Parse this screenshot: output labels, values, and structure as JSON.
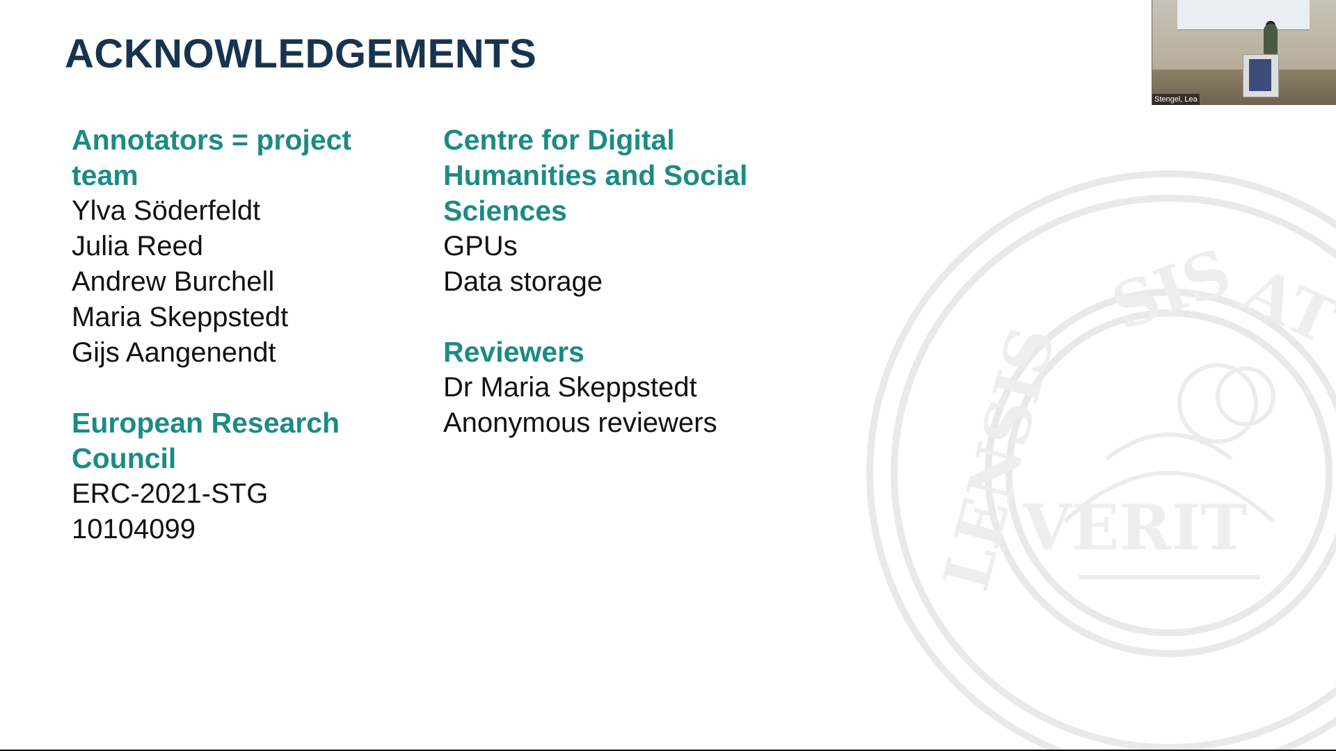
{
  "slide": {
    "title": "ACKNOWLEDGEMENTS",
    "left_column": [
      {
        "heading": "Annotators = project team",
        "items": [
          "Ylva Söderfeldt",
          "Julia Reed",
          "Andrew Burchell",
          "Maria Skeppstedt",
          "Gijs Aangenendt"
        ]
      },
      {
        "heading": "European Research Council",
        "items": [
          "ERC-2021-STG",
          "10104099"
        ]
      }
    ],
    "right_column": [
      {
        "heading": "Centre for Digital Humanities and Social Sciences",
        "items": [
          "GPUs",
          "Data storage"
        ]
      },
      {
        "heading": "Reviewers",
        "items": [
          "Dr Maria Skeppstedt",
          "Anonymous reviewers"
        ]
      }
    ]
  },
  "video": {
    "participant_name": "Stengel, Lea"
  },
  "colors": {
    "title": "#17344f",
    "heading_accent": "#1c8a86",
    "body_text": "#111111",
    "background": "#ffffff"
  },
  "icons": {
    "watermark": "university-seal"
  }
}
